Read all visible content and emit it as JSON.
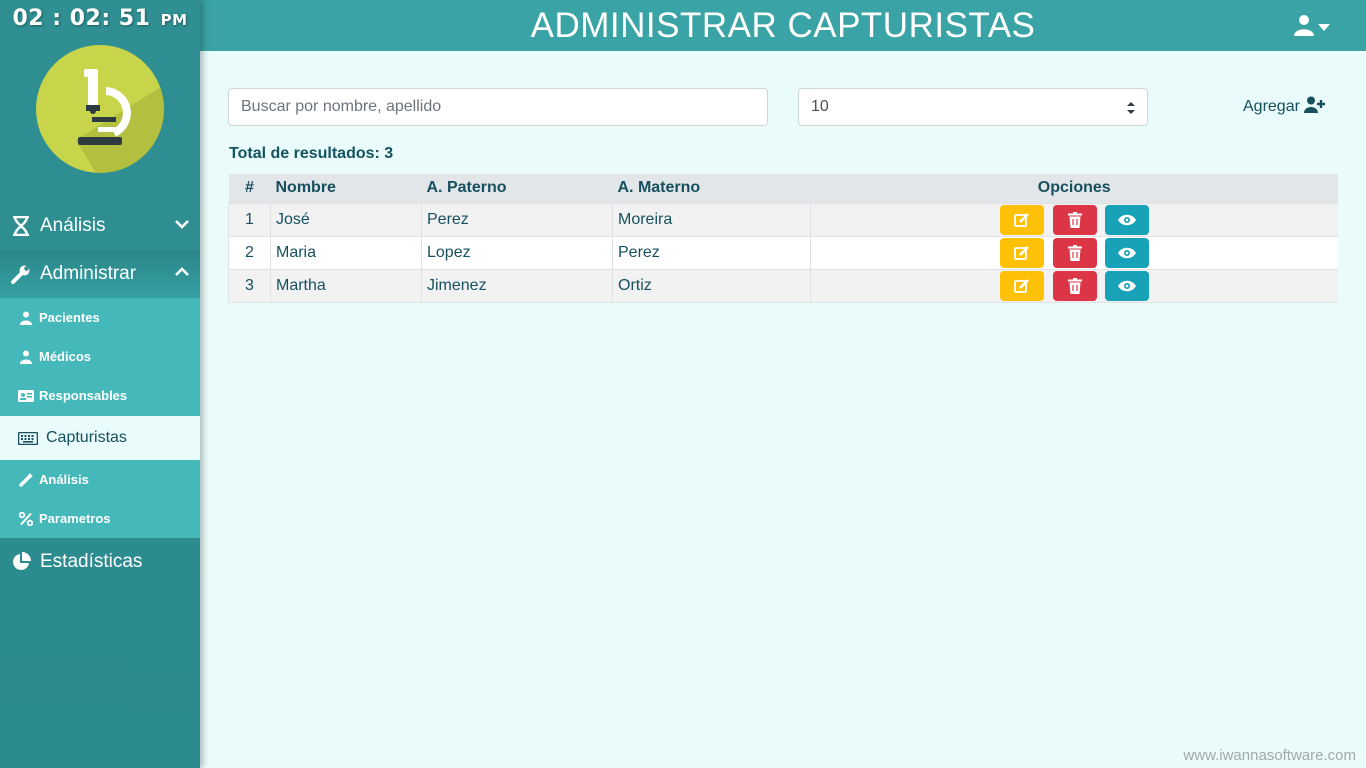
{
  "clock": {
    "time": "02 : 02: 51",
    "ampm": "PM"
  },
  "header": {
    "title": "ADMINISTRAR CAPTURISTAS"
  },
  "sidebar": {
    "analisis_label": "Análisis",
    "admin_label": "Administrar",
    "estadisticas_label": "Estadísticas",
    "sub_items": [
      {
        "label": "Pacientes",
        "icon": "user-md-icon"
      },
      {
        "label": "Médicos",
        "icon": "user-md-icon"
      },
      {
        "label": "Responsables",
        "icon": "id-card-icon"
      },
      {
        "label": "Capturistas",
        "icon": "keyboard-icon",
        "active": true
      },
      {
        "label": "Análisis",
        "icon": "syringe-icon"
      },
      {
        "label": "Parametros",
        "icon": "percent-icon"
      }
    ]
  },
  "search": {
    "placeholder": "Buscar por nombre, apellido"
  },
  "page_size": {
    "value": "10"
  },
  "add": {
    "label": "Agregar"
  },
  "results": {
    "total_label": "Total de resultados: 3"
  },
  "table": {
    "headers": [
      "#",
      "Nombre",
      "A. Paterno",
      "A. Materno",
      "Opciones"
    ],
    "rows": [
      {
        "num": "1",
        "nombre": "José",
        "paterno": "Perez",
        "materno": "Moreira"
      },
      {
        "num": "2",
        "nombre": "Maria",
        "paterno": "Lopez",
        "materno": "Perez"
      },
      {
        "num": "3",
        "nombre": "Martha",
        "paterno": "Jimenez",
        "materno": "Ortiz"
      }
    ]
  },
  "footer": {
    "text": "www.iwannasoftware.com"
  },
  "colors": {
    "sidebar": "#2f8f92",
    "header": "#3aa3a6",
    "submenu": "#45b8b9",
    "background": "#e9fbfa",
    "edit": "#ffc107",
    "delete": "#dc3545",
    "view": "#17a2b8",
    "text": "#16505f"
  }
}
